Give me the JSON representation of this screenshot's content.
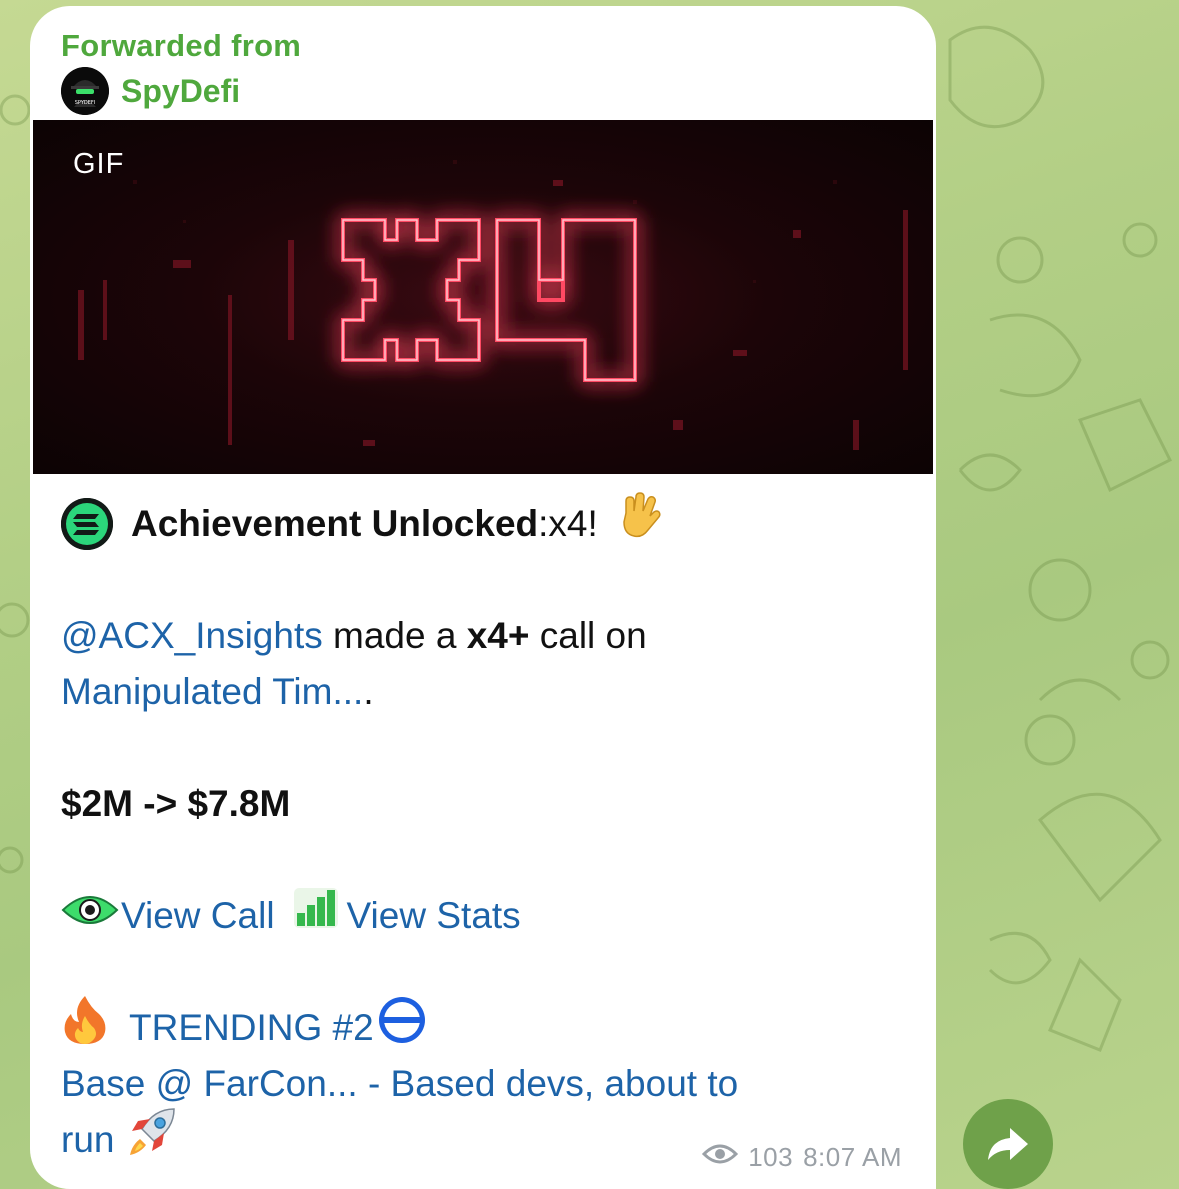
{
  "message": {
    "forwarded_label": "Forwarded from",
    "source_name": "SpyDefi",
    "avatar_text": "SPYDEFI",
    "media": {
      "badge": "GIF",
      "neon_text": "x4"
    },
    "achievement": {
      "title": "Achievement Unlocked",
      "colon": ":",
      "value": " x4!"
    },
    "call": {
      "caller": "@ACX_Insights",
      "made_text": " made a ",
      "multiplier": "x4+",
      "call_on": " call on",
      "token_link": "Manipulated Tim...",
      "trailing_dot": "."
    },
    "market_cap": "$2M -> $7.8M",
    "actions": {
      "view_call": "View Call",
      "view_stats": "View Stats"
    },
    "trending": {
      "label": "TRENDING #2",
      "link_line1": "Base @ FarCon... - Based devs, about to",
      "link_line2": "run"
    },
    "views": "103",
    "time": "8:07 AM"
  },
  "colors": {
    "accent_green": "#4fa83d",
    "link_blue": "#1d63a8",
    "share_button": "#6fa14a",
    "neon": "#ff3b55"
  }
}
